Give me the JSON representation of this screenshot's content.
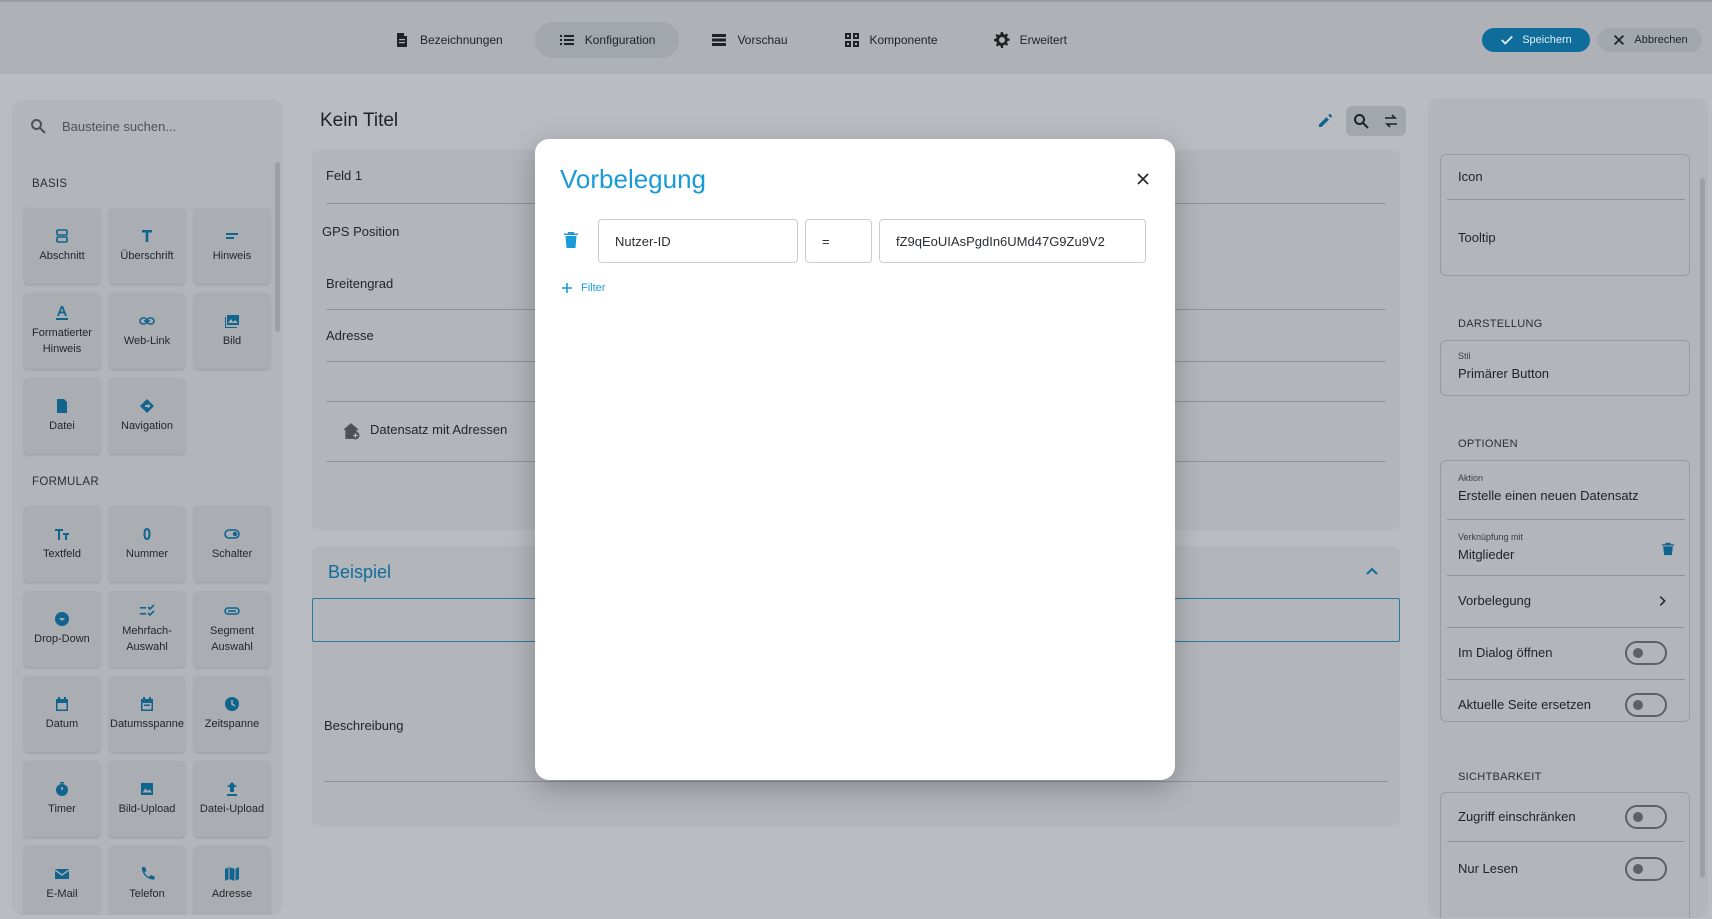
{
  "topbar": {
    "tabs": [
      {
        "label": "Bezeichnungen",
        "icon": "document-icon"
      },
      {
        "label": "Konfiguration",
        "icon": "list-icon"
      },
      {
        "label": "Vorschau",
        "icon": "table-icon"
      },
      {
        "label": "Komponente",
        "icon": "grid-icon"
      },
      {
        "label": "Erweitert",
        "icon": "gear-icon"
      }
    ],
    "save_label": "Speichern",
    "cancel_label": "Abbrechen"
  },
  "palette": {
    "search_placeholder": "Bausteine suchen...",
    "section_basis": "BASIS",
    "basis_items": [
      "Abschnitt",
      "Überschrift",
      "Hinweis",
      "Formatierter Hinweis",
      "Web-Link",
      "Bild",
      "Datei",
      "Navigation"
    ],
    "section_formular": "FORMULAR",
    "formular_items": [
      "Textfeld",
      "Nummer",
      "Schalter",
      "Drop-Down",
      "Mehrfach-Auswahl",
      "Segment Auswahl",
      "Datum",
      "Datumsspanne",
      "Zeitspanne",
      "Timer",
      "Bild-Upload",
      "Datei-Upload",
      "E-Mail",
      "Telefon",
      "Adresse"
    ]
  },
  "editor": {
    "title": "Kein Titel",
    "rows": [
      "Feld 1",
      "GPS Position",
      "Breitengrad",
      "Adresse",
      "Datensatz mit Adressen"
    ],
    "section_title": "Beispiel",
    "beschreibung": "Beschreibung"
  },
  "properties": {
    "icon_label": "Icon",
    "tooltip_label": "Tooltip",
    "darstellung": "DARSTELLUNG",
    "stil_label": "Stil",
    "stil_value": "Primärer Button",
    "optionen": "OPTIONEN",
    "aktion_label": "Aktion",
    "aktion_value": "Erstelle einen neuen Datensatz",
    "verknuepfung_label": "Verknüpfung mit",
    "verknuepfung_value": "Mitglieder",
    "vorbelegung": "Vorbelegung",
    "dialog": "Im Dialog öffnen",
    "ersetzen": "Aktuelle Seite ersetzen",
    "sichtbarkeit": "SICHTBARKEIT",
    "zugriff": "Zugriff einschränken",
    "nur_lesen": "Nur Lesen"
  },
  "modal": {
    "title": "Vorbelegung",
    "field_name": "Nutzer-ID",
    "operator": "=",
    "value": "fZ9qEoUIAsPgdIn6UMd47G9Zu9V2",
    "add_filter": "Filter"
  },
  "colors": {
    "accent": "#1a9ad6",
    "overlay_accent": "#0f6d9b"
  }
}
